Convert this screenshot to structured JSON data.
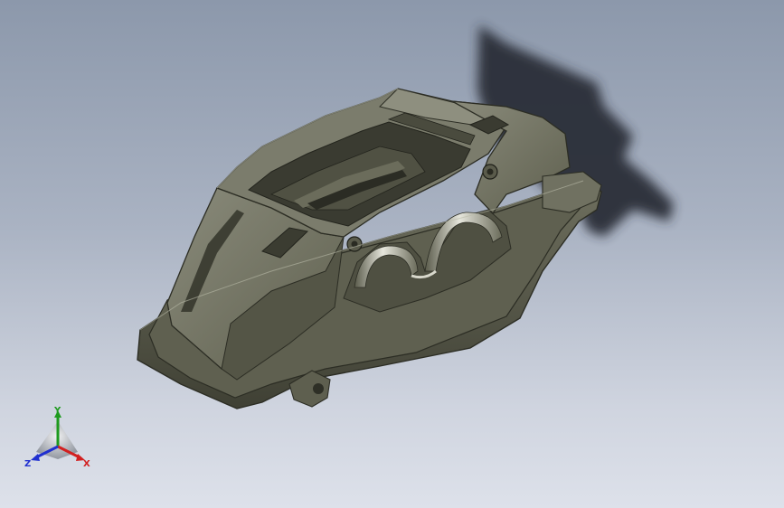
{
  "viewport": {
    "background_top": "#8c98ab",
    "background_bottom": "#dde1ea"
  },
  "model": {
    "icon": "brake-caliper-model",
    "color": "#6d6e5e",
    "shadow_color": "#2b2f38"
  },
  "triad": {
    "x_label": "X",
    "y_label": "Y",
    "z_label": "Z",
    "x_color": "#d22020",
    "y_color": "#1e9a1e",
    "z_color": "#2030d0"
  }
}
